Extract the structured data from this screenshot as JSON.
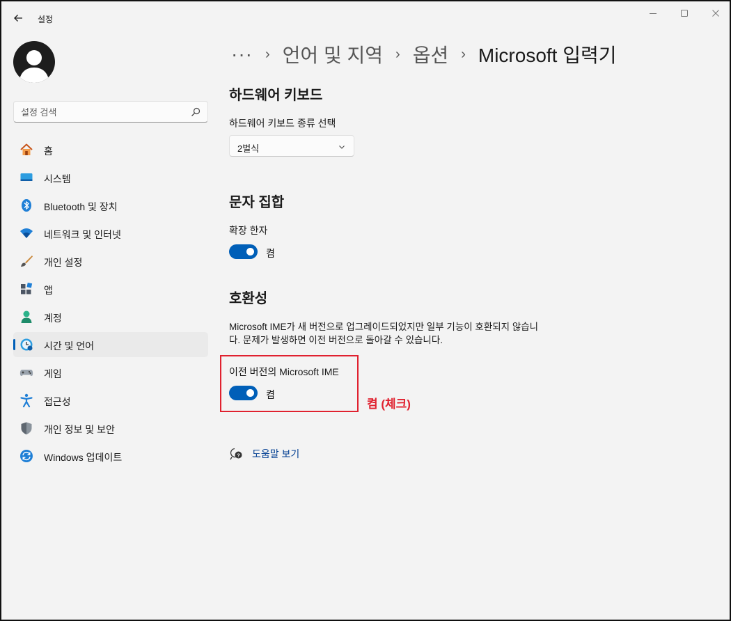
{
  "window": {
    "title": "설정"
  },
  "search": {
    "placeholder": "설정 검색"
  },
  "sidebar": {
    "items": [
      {
        "label": "홈",
        "icon": "home-icon"
      },
      {
        "label": "시스템",
        "icon": "system-icon"
      },
      {
        "label": "Bluetooth 및 장치",
        "icon": "bluetooth-icon"
      },
      {
        "label": "네트워크 및 인터넷",
        "icon": "wifi-icon"
      },
      {
        "label": "개인 설정",
        "icon": "brush-icon"
      },
      {
        "label": "앱",
        "icon": "apps-icon"
      },
      {
        "label": "계정",
        "icon": "account-icon"
      },
      {
        "label": "시간 및 언어",
        "icon": "time-language-icon",
        "active": true
      },
      {
        "label": "게임",
        "icon": "gamepad-icon"
      },
      {
        "label": "접근성",
        "icon": "accessibility-icon"
      },
      {
        "label": "개인 정보 및 보안",
        "icon": "shield-icon"
      },
      {
        "label": "Windows 업데이트",
        "icon": "update-icon"
      }
    ]
  },
  "breadcrumb": {
    "more": "···",
    "items": [
      "언어 및 지역",
      "옵션"
    ],
    "current": "Microsoft 입력기"
  },
  "hardware_keyboard": {
    "title": "하드웨어 키보드",
    "select_label": "하드웨어 키보드 종류 선택",
    "selected": "2벌식"
  },
  "charset": {
    "title": "문자 집합",
    "option_label": "확장 한자",
    "toggle_state": "켬",
    "toggle_on": true
  },
  "compat": {
    "title": "호환성",
    "description": "Microsoft IME가 새 버전으로 업그레이드되었지만 일부 기능이 호환되지 않습니다. 문제가 발생하면 이전 버전으로 돌아갈 수 있습니다.",
    "option_label": "이전 버전의 Microsoft IME",
    "toggle_state": "켬",
    "toggle_on": true
  },
  "annotation": {
    "text": "켬 (체크)",
    "color": "#e0212f"
  },
  "help": {
    "label": "도움말 보기"
  },
  "colors": {
    "accent": "#005fb8",
    "link": "#003e92"
  }
}
